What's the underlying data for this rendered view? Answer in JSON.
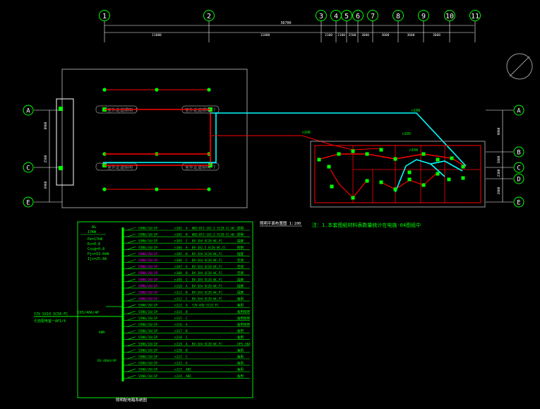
{
  "colors": {
    "background": "#000000",
    "grid": "#ffffff",
    "green": "#00ff00",
    "cyan": "#00ffff",
    "red": "#ff0000",
    "magenta": "#ff00ff",
    "yellow": "#ffff00",
    "wall": "#9a9a9a"
  },
  "axes_top": [
    "1",
    "2",
    "3",
    "4",
    "5",
    "6",
    "7",
    "8",
    "9",
    "10",
    "11"
  ],
  "axes_left": [
    "A",
    "C",
    "E"
  ],
  "axes_right": [
    "A",
    "B",
    "C",
    "D",
    "E"
  ],
  "dim_total": "36700",
  "dims_top": [
    "11800",
    "11800",
    "2100",
    "2100",
    "2500",
    "3600",
    "3600",
    "3600",
    "3600"
  ],
  "dims_left": [
    "8900",
    "2500",
    "6900"
  ],
  "dims_right": [
    "9800",
    "5800",
    "2300",
    "2800"
  ],
  "drawing_tags": {
    "corridor_left_upper": "室外走道照明 7",
    "corridor_right_upper": "室外走道照明 7",
    "corridor_left_lower": "室外走道照明 7",
    "corridor_right_lower": "室外走道照明 7",
    "route_a": "n108",
    "route_b": "n106",
    "route_c": "n105",
    "route_d": "n104"
  },
  "plan_title": "照明平面布置图 1:100",
  "note": "注：1.本套图纸材料表数量统计在电施-04图纸中",
  "panel": {
    "title": "AL",
    "rating": "17KW",
    "params": [
      "Pe=17kW",
      "Kx=0.8",
      "Cos@=0.8",
      "Pjs=13.6kW",
      "Ijs=25.8A"
    ],
    "incoming_cable": "YJV-5X10 SC50-FC",
    "incoming_method": "引自配电室一AP1/4",
    "main_breaker": "C65/40A/4P",
    "meter": "kWh",
    "spd": "DX-40kA/4P",
    "bottom_label": "照明配电箱系统图"
  },
  "circuits": [
    {
      "breaker": "S5N6/10/1P",
      "num": "n101",
      "phase": "A",
      "cable": "WDZ-BYJ-3X2.5 SC20-CC,WC",
      "use": "照明"
    },
    {
      "breaker": "S5N6/10/1P",
      "num": "n102",
      "phase": "B",
      "cable": "WDZ-BYJ-3X2.5 SC20-CC,WC",
      "use": "照明"
    },
    {
      "breaker": "S5N6/16/1P",
      "num": "n103",
      "phase": "C",
      "cable": "BV-3X4 SC20 WC,FC",
      "use": "插座"
    },
    {
      "breaker": "S5N6/10/1P",
      "num": "n104",
      "phase": "A",
      "cable": "BV-3X2.5 SC20 WC,CC",
      "use": "照明"
    },
    {
      "breaker": "S5N6/20/1P",
      "num": "n105",
      "phase": "B",
      "cable": "BV-3X4 SC20 WC,FC",
      "use": "插座"
    },
    {
      "breaker": "S5N6/20/1P",
      "num": "n106",
      "phase": "C",
      "cable": "BV-3X4 SC20 WC,FC",
      "use": "空调"
    },
    {
      "breaker": "S5N6/20/1P",
      "num": "n107",
      "phase": "A",
      "cable": "BV-3X4 SC20 WC,FC",
      "use": "空调"
    },
    {
      "breaker": "S5N6/20/1P",
      "num": "n108",
      "phase": "B",
      "cable": "BV-3X4 SC20 WC,FC",
      "use": "空调"
    },
    {
      "breaker": "S5N6/20/1P",
      "num": "n109",
      "phase": "C",
      "cable": "BV-3X4 SC20 WC,FC",
      "use": "插座"
    },
    {
      "breaker": "S5N6/20/1P",
      "num": "n110",
      "phase": "A",
      "cable": "BV-3X4 SC20 WC,FC",
      "use": "插座"
    },
    {
      "breaker": "S5N6/20/1P",
      "num": "n111",
      "phase": "B",
      "cable": "BV-3X4 SC20 WC,FC",
      "use": "插座"
    },
    {
      "breaker": "S5N6/20/1P",
      "num": "n112",
      "phase": "C",
      "cable": "BV-3X4 SC20 WC,FC",
      "use": "备用"
    },
    {
      "breaker": "S5N6/20/1P",
      "num": "n113",
      "phase": "A",
      "cable": "YJV-4X6 SC32 FC",
      "use": "备用"
    },
    {
      "breaker": "S5N6/10/1P",
      "num": "n114",
      "phase": "B",
      "cable": "",
      "use": "备用照明"
    },
    {
      "breaker": "S5N6/10/1P",
      "num": "n115",
      "phase": "C",
      "cable": "",
      "use": "备用照明"
    },
    {
      "breaker": "S5N6/10/1P",
      "num": "n116",
      "phase": "A",
      "cable": "",
      "use": "备用照明"
    },
    {
      "breaker": "S5N6/10/1P",
      "num": "n117",
      "phase": "B",
      "cable": "",
      "use": "备用"
    },
    {
      "breaker": "S5N6/10/1P",
      "num": "n118",
      "phase": "C",
      "cable": "",
      "use": "备用"
    },
    {
      "breaker": "S5N6/10/1P",
      "num": "n119",
      "phase": "A",
      "cable": "BV-3X4 SC20 WC,FC",
      "use": "UPS-30A"
    },
    {
      "breaker": "S5N6/10/1P",
      "num": "n120",
      "phase": "B",
      "cable": "",
      "use": "备用"
    },
    {
      "breaker": "S5N6/10/1P",
      "num": "n121",
      "phase": "C",
      "cable": "",
      "use": "备用"
    },
    {
      "breaker": "S5N6/10/1P",
      "num": "n122",
      "phase": "A",
      "cable": "",
      "use": "备用"
    },
    {
      "breaker": "S5N6/20/1P",
      "num": "n123",
      "phase": "ABC",
      "cable": "",
      "use": "备用"
    },
    {
      "breaker": "S5N6/10/1P",
      "num": "n124",
      "phase": "ABC",
      "cable": "",
      "use": "备用"
    }
  ]
}
